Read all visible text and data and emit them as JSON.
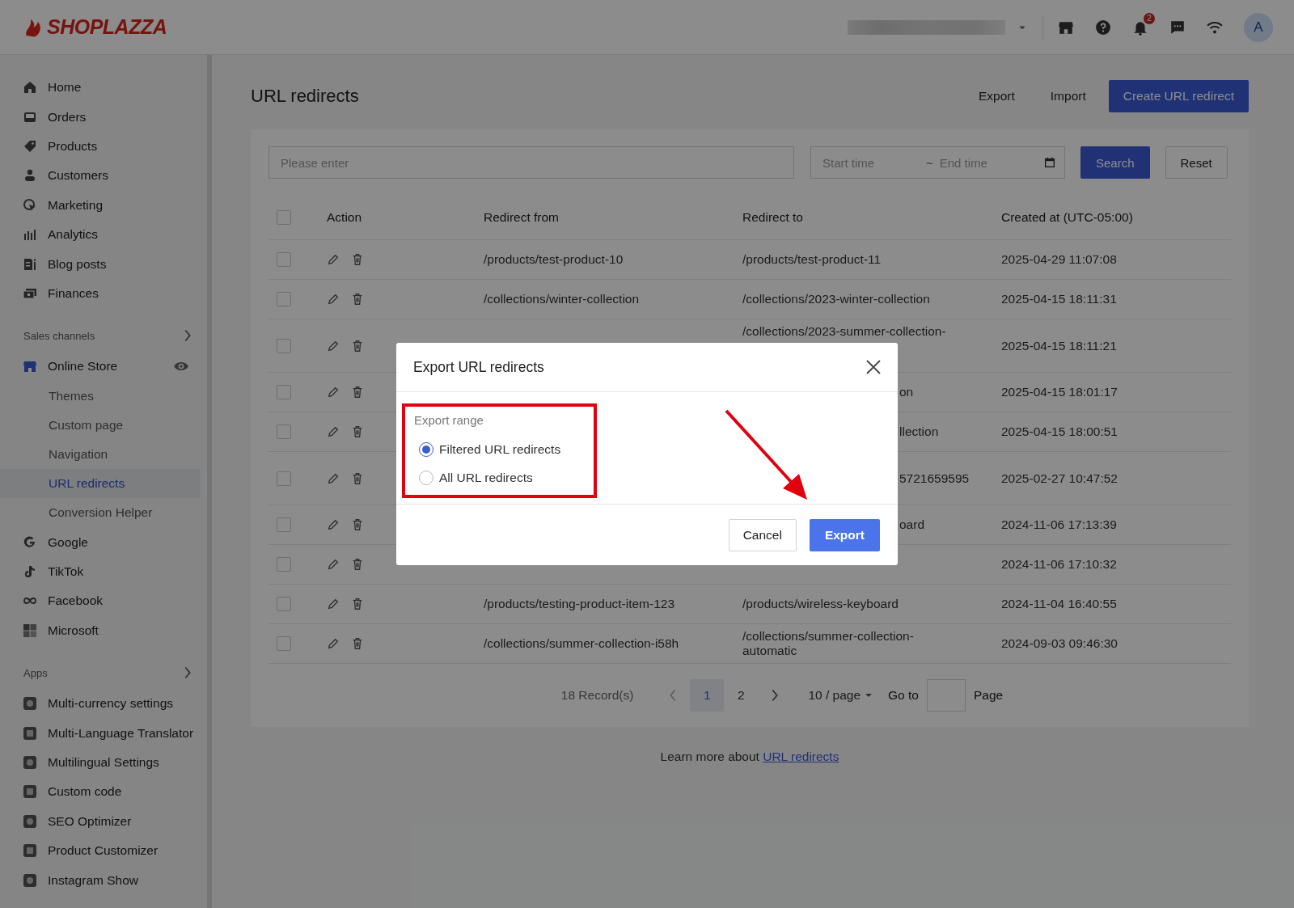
{
  "topbar": {
    "logo": "SHOPLAZZA",
    "notification_count": "2",
    "avatar": "A"
  },
  "sidebar": {
    "items": [
      {
        "label": "Home",
        "selected": false
      },
      {
        "label": "Orders",
        "selected": false
      },
      {
        "label": "Products",
        "selected": false
      },
      {
        "label": "Customers",
        "selected": false
      },
      {
        "label": "Marketing",
        "selected": false
      },
      {
        "label": "Analytics",
        "selected": false
      },
      {
        "label": "Blog posts",
        "selected": false
      },
      {
        "label": "Finances",
        "selected": false
      }
    ],
    "sales_channels": {
      "title": "Sales channels",
      "items": [
        {
          "label": "Online Store",
          "selected": false,
          "children": [
            {
              "label": "Themes",
              "selected": false
            },
            {
              "label": "Custom page",
              "selected": false
            },
            {
              "label": "Navigation",
              "selected": false
            },
            {
              "label": "URL redirects",
              "selected": true
            },
            {
              "label": "Conversion Helper",
              "selected": false
            }
          ]
        },
        {
          "label": "Google",
          "selected": false
        },
        {
          "label": "TikTok",
          "selected": false
        },
        {
          "label": "Facebook",
          "selected": false
        },
        {
          "label": "Microsoft",
          "selected": false
        }
      ]
    },
    "apps": {
      "title": "Apps",
      "items": [
        {
          "label": "Multi-currency settings",
          "selected": false
        },
        {
          "label": "Multi-Language Translator",
          "selected": false
        },
        {
          "label": "Multilingual Settings",
          "selected": false
        },
        {
          "label": "Custom code",
          "selected": false
        },
        {
          "label": "SEO Optimizer",
          "selected": false
        },
        {
          "label": "Product Customizer",
          "selected": false
        },
        {
          "label": "Instagram Show",
          "selected": false
        }
      ]
    }
  },
  "page": {
    "title": "URL redirects",
    "actions": [
      "Export",
      "Import"
    ],
    "primary_action": "Create URL redirect"
  },
  "filter": {
    "placeholder": "Please enter",
    "start_placeholder": "Start time",
    "separator": "~",
    "end_placeholder": "End time",
    "search": "Search",
    "reset": "Reset"
  },
  "table": {
    "checked": false,
    "columns": [
      "Action",
      "Redirect from",
      "Redirect to",
      "Created at (UTC-05:00)"
    ],
    "rows": [
      {
        "checked": false,
        "from": "/products/test-product-10",
        "to": "/products/test-product-11",
        "created": "2025-04-29 11:07:08"
      },
      {
        "checked": false,
        "from": "/collections/winter-collection",
        "to": "/collections/2023-winter-collection",
        "created": "2025-04-15 18:11:31"
      },
      {
        "checked": false,
        "to": "/collections/2023-summer-collection-",
        "created": "2025-04-15 18:11:21"
      },
      {
        "checked": false,
        "to_visible_part": "on",
        "created": "2025-04-15 18:01:17"
      },
      {
        "checked": false,
        "to_visible_part": "llection",
        "created": "2025-04-15 18:00:51"
      },
      {
        "checked": false,
        "to_visible_part": "5721659595",
        "created": "2025-02-27 10:47:52"
      },
      {
        "checked": false,
        "to_visible_part": "oard",
        "created": "2024-11-06 17:13:39"
      },
      {
        "checked": false,
        "created": "2024-11-06 17:10:32"
      },
      {
        "checked": false,
        "from": "/products/testing-product-item-123",
        "to": "/products/wireless-keyboard",
        "created": "2024-11-04 16:40:55"
      },
      {
        "checked": false,
        "from": "/collections/summer-collection-i58h",
        "to": "/collections/summer-collection-automatic",
        "created": "2024-09-03 09:46:30"
      }
    ]
  },
  "pagination": {
    "records": "18 Record(s)",
    "pages": [
      {
        "label": "1",
        "selected": true
      },
      {
        "label": "2",
        "selected": false
      }
    ],
    "page_size": "10 / page",
    "goto_label": "Go to",
    "page_label": "Page"
  },
  "footer": {
    "text": "Learn more about",
    "link": "URL redirects"
  },
  "modal": {
    "title": "Export URL redirects",
    "field_label": "Export range",
    "options": [
      {
        "label": "Filtered URL redirects",
        "selected": true
      },
      {
        "label": "All URL redirects",
        "selected": false
      }
    ],
    "cancel": "Cancel",
    "confirm": "Export"
  }
}
